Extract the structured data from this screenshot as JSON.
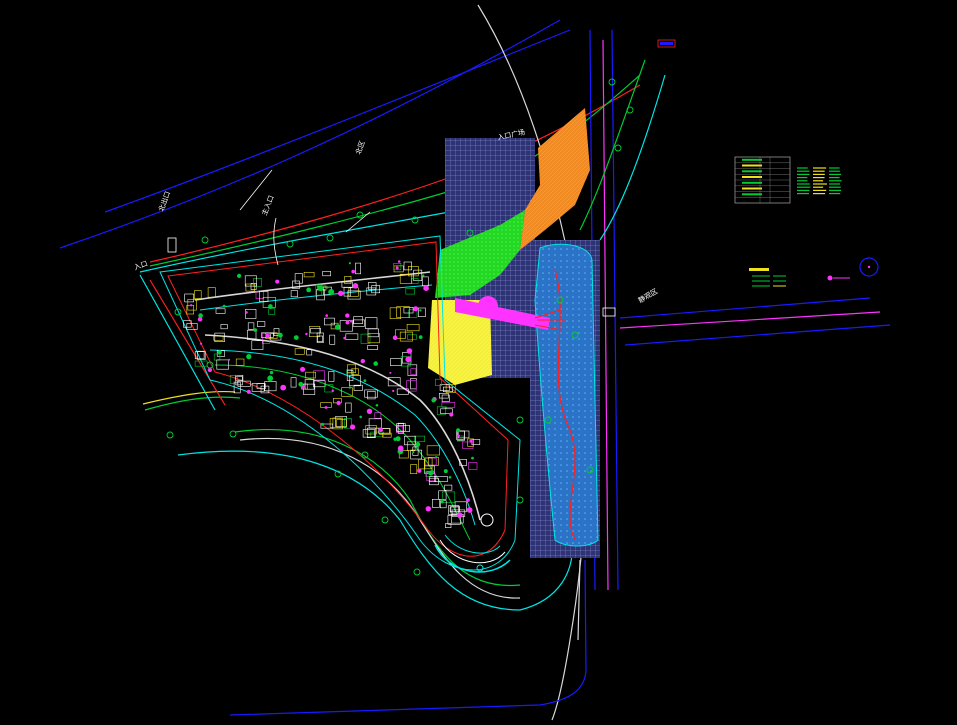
{
  "drawing": {
    "background": "#000000",
    "colors": {
      "road_blue": "#1a1aff",
      "road_cyan": "#00e5e5",
      "road_green": "#00cc33",
      "road_red": "#ff2020",
      "road_magenta": "#ff33ff",
      "road_white": "#d8d8d8",
      "grid_block": "#3a3f86",
      "grid_line": "#8d93d6",
      "orange_zone": "#f08a22",
      "green_zone": "#22e022",
      "yellow_zone": "#f7f24a",
      "water_zone": "#2a73c6",
      "building_yellow": "#f0e11e",
      "building_white": "#ffffff"
    },
    "labels": {
      "south_road": "北出口",
      "north_gate": "主入口",
      "mid_road": "北区",
      "district_right": "静观区",
      "plaza_top": "入口广场",
      "corner_label": "入口"
    },
    "legend_block": {
      "table_rows": 8,
      "text_columns": 3
    }
  }
}
